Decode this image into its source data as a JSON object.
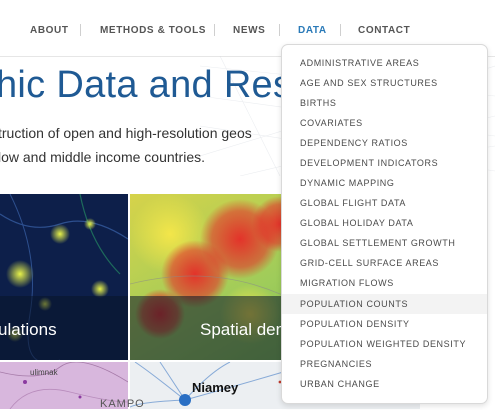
{
  "nav": {
    "items": [
      {
        "label": "ABOUT"
      },
      {
        "label": "METHODS & TOOLS"
      },
      {
        "label": "NEWS"
      },
      {
        "label": "DATA"
      },
      {
        "label": "CONTACT"
      }
    ],
    "active": "DATA"
  },
  "hero": {
    "title": "hic Data and Res",
    "subtitle_line1": "truction of open and high-resolution geos",
    "subtitle_line2": "low and middle income countries."
  },
  "tiles": {
    "tile1_caption": "ulations",
    "tile2_caption": "Spatial dem",
    "tile3_map_text": "KAMPO",
    "tile3_small_text": "ulimnak",
    "tile4_map_text": "Niamey"
  },
  "dropdown": {
    "items": [
      "ADMINISTRATIVE AREAS",
      "AGE AND SEX STRUCTURES",
      "BIRTHS",
      "COVARIATES",
      "DEPENDENCY RATIOS",
      "DEVELOPMENT INDICATORS",
      "DYNAMIC MAPPING",
      "GLOBAL FLIGHT DATA",
      "GLOBAL HOLIDAY DATA",
      "GLOBAL SETTLEMENT GROWTH",
      "GRID-CELL SURFACE AREAS",
      "MIGRATION FLOWS",
      "POPULATION COUNTS",
      "POPULATION DENSITY",
      "POPULATION WEIGHTED DENSITY",
      "PREGNANCIES",
      "URBAN CHANGE"
    ],
    "hovered": "POPULATION COUNTS"
  },
  "colors": {
    "accent": "#2a7ab8",
    "title_blue": "#1f5a94",
    "nav_text": "#555555"
  }
}
